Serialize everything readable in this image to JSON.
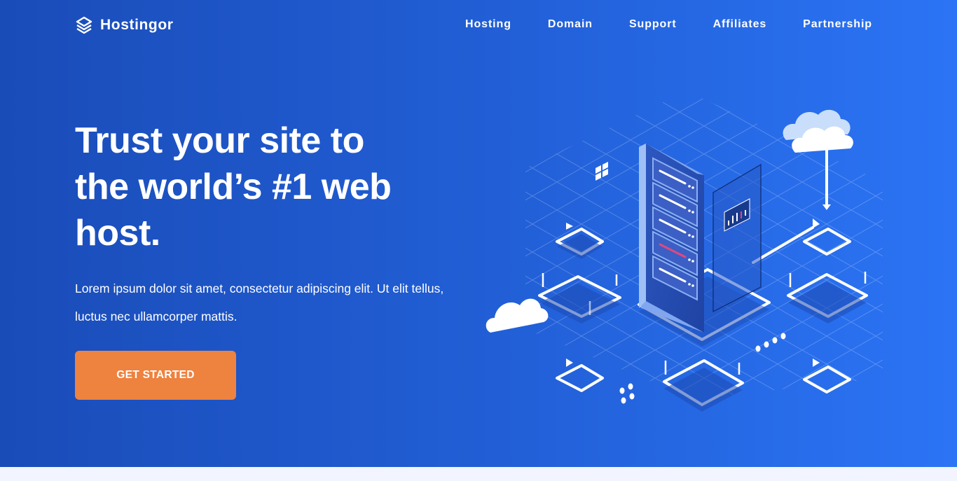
{
  "brand": {
    "name": "Hostingor",
    "logo_icon": "stacked-layers-logo-icon"
  },
  "nav": {
    "items": [
      {
        "label": "Hosting"
      },
      {
        "label": "Domain"
      },
      {
        "label": "Support"
      },
      {
        "label": "Affiliates"
      },
      {
        "label": "Partnership"
      }
    ]
  },
  "hero": {
    "headline_line1": "Trust your site to",
    "headline_line2": "the world’s #1 web",
    "headline_line3": "host.",
    "lead": "Lorem ipsum dolor sit amet, consectetur adipiscing elit. Ut elit tellus, luctus nec ullamcorper mattis.",
    "cta_label": "GET STARTED",
    "illustration": "isometric-server-network-illustration"
  },
  "colors": {
    "hero_gradient_start": "#1a4cb8",
    "hero_gradient_end": "#2b74f5",
    "cta": "#ee823f",
    "text": "#ffffff",
    "accent_pink": "#e0487f",
    "server_panel": "#3f6fd6",
    "page_bg": "#f2f5ff"
  }
}
